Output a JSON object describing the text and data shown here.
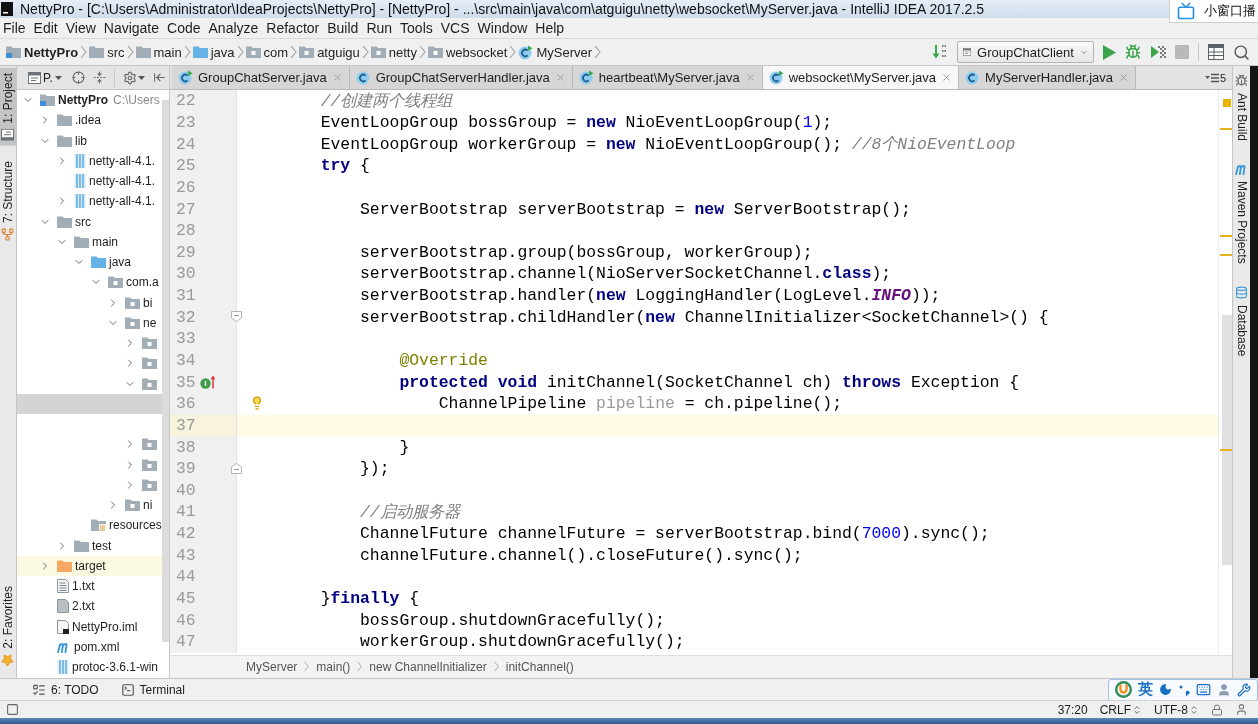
{
  "window": {
    "title": "NettyPro - [C:\\Users\\Administrator\\IdeaProjects\\NettyPro] - [NettyPro] - ...\\src\\main\\java\\com\\atguigu\\netty\\websocket\\MyServer.java - IntelliJ IDEA 2017.2.5"
  },
  "popup": {
    "label": "小窗口播"
  },
  "menu": [
    "File",
    "Edit",
    "View",
    "Navigate",
    "Code",
    "Analyze",
    "Refactor",
    "Build",
    "Run",
    "Tools",
    "VCS",
    "Window",
    "Help"
  ],
  "navigation": {
    "crumbs": [
      {
        "label": "NettyPro",
        "kind": "module"
      },
      {
        "label": "src",
        "kind": "folder"
      },
      {
        "label": "main",
        "kind": "folder"
      },
      {
        "label": "java",
        "kind": "source_folder"
      },
      {
        "label": "com",
        "kind": "package"
      },
      {
        "label": "atguigu",
        "kind": "package"
      },
      {
        "label": "netty",
        "kind": "package"
      },
      {
        "label": "websocket",
        "kind": "package"
      },
      {
        "label": "MyServer",
        "kind": "runnable_class"
      }
    ],
    "run_configuration": "GroupChatClient"
  },
  "left_tool_buttons": [
    {
      "label": "1: Project",
      "kind": "project",
      "selected": true
    },
    {
      "label": "7: Structure",
      "kind": "structure",
      "selected": false
    },
    {
      "label": "2: Favorites",
      "kind": "favorites",
      "selected": false
    }
  ],
  "project_panel": {
    "view": "P.",
    "tree": [
      {
        "label": "NettyPro",
        "location": "C:\\Users",
        "kind": "module",
        "expanded": true,
        "selected": false,
        "children": [
          {
            "label": ".idea",
            "kind": "folder",
            "expanded": false,
            "selected": false
          },
          {
            "label": "lib",
            "kind": "folder",
            "expanded": true,
            "selected": false,
            "children": [
              {
                "label": "netty-all-4.1.",
                "kind": "archive",
                "expanded": false,
                "selected": false
              },
              {
                "label": "netty-all-4.1.",
                "kind": "archive",
                "selected": false
              },
              {
                "label": "netty-all-4.1.",
                "kind": "archive",
                "expanded": false,
                "selected": false
              }
            ]
          },
          {
            "label": "src",
            "kind": "folder",
            "expanded": true,
            "selected": false,
            "children": [
              {
                "label": "main",
                "kind": "folder",
                "expanded": true,
                "selected": false,
                "children": [
                  {
                    "label": "java",
                    "kind": "source_folder",
                    "expanded": true,
                    "selected": false,
                    "children": [
                      {
                        "label": "com.a",
                        "kind": "package",
                        "expanded": true,
                        "selected": false,
                        "children": [
                          {
                            "label": "bi",
                            "kind": "package",
                            "expanded": false,
                            "selected": false
                          },
                          {
                            "label": "ne",
                            "kind": "package",
                            "expanded": true,
                            "selected": false,
                            "children": [
                              {
                                "kind": "package",
                                "expanded": false,
                                "selected": false
                              },
                              {
                                "kind": "package",
                                "expanded": false,
                                "selected": false
                              },
                              {
                                "kind": "package",
                                "expanded": true,
                                "selected": false,
                                "children": [
                                  {
                                    "selected": true
                                  },
                                  {
                                    "selected": false
                                  }
                                ]
                              },
                              {
                                "kind": "package",
                                "expanded": false,
                                "selected": false
                              },
                              {
                                "kind": "package",
                                "expanded": false,
                                "selected": false
                              },
                              {
                                "kind": "package",
                                "expanded": false,
                                "selected": false
                              }
                            ]
                          },
                          {
                            "label": "ni",
                            "kind": "package",
                            "expanded": false,
                            "selected": false
                          }
                        ]
                      }
                    ]
                  },
                  {
                    "label": "resources",
                    "kind": "resources_folder",
                    "selected": false
                  }
                ]
              },
              {
                "label": "test",
                "kind": "folder",
                "expanded": false,
                "selected": false
              }
            ]
          },
          {
            "label": "target",
            "kind": "excluded_folder",
            "expanded": false,
            "selected": false
          },
          {
            "label": "1.txt",
            "kind": "text_file",
            "selected": false
          },
          {
            "label": "2.txt",
            "kind": "unknown_file",
            "selected": false
          },
          {
            "label": "NettyPro.iml",
            "kind": "module_file",
            "selected": false
          },
          {
            "label": "pom.xml",
            "kind": "maven_file",
            "selected": false
          },
          {
            "label": "protoc-3.6.1-win",
            "kind": "archive",
            "selected": false
          }
        ]
      }
    ]
  },
  "editor": {
    "tabs": [
      {
        "label": "GroupChatServer.java",
        "kind": "runnable_class",
        "selected": false
      },
      {
        "label": "GroupChatServerHandler.java",
        "kind": "class",
        "selected": false
      },
      {
        "label": "heartbeat\\MyServer.java",
        "kind": "runnable_class",
        "selected": false
      },
      {
        "label": "websocket\\MyServer.java",
        "kind": "runnable_class",
        "selected": true
      },
      {
        "label": "MyServerHandler.java",
        "kind": "class",
        "selected": false
      }
    ],
    "hidden_tab_count": "5",
    "lines": [
      {
        "number": "22",
        "kind": "plain",
        "current": false,
        "tokens": [
          {
            "text": "        //创建两个线程组",
            "kind": "comment"
          }
        ]
      },
      {
        "number": "23",
        "kind": "plain",
        "current": false,
        "tokens": [
          {
            "text": "        EventLoopGroup bossGroup = ",
            "kind": "plain"
          },
          {
            "text": "new",
            "kind": "keyword"
          },
          {
            "text": " NioEventLoopGroup(",
            "kind": "plain"
          },
          {
            "text": "1",
            "kind": "number"
          },
          {
            "text": ");",
            "kind": "plain"
          }
        ]
      },
      {
        "number": "24",
        "kind": "plain",
        "current": false,
        "tokens": [
          {
            "text": "        EventLoopGroup workerGroup = ",
            "kind": "plain"
          },
          {
            "text": "new",
            "kind": "keyword"
          },
          {
            "text": " NioEventLoopGroup(); ",
            "kind": "plain"
          },
          {
            "text": "//8个NioEventLoop",
            "kind": "comment"
          }
        ]
      },
      {
        "number": "25",
        "kind": "plain",
        "current": false,
        "tokens": [
          {
            "text": "        try",
            "kind": "keyword"
          },
          {
            "text": " {",
            "kind": "plain"
          }
        ]
      },
      {
        "number": "26",
        "kind": "plain",
        "current": false
      },
      {
        "number": "27",
        "kind": "plain",
        "current": false,
        "tokens": [
          {
            "text": "            ServerBootstrap serverBootstrap = ",
            "kind": "plain"
          },
          {
            "text": "new",
            "kind": "keyword"
          },
          {
            "text": " ServerBootstrap();",
            "kind": "plain"
          }
        ]
      },
      {
        "number": "28",
        "kind": "plain",
        "current": false
      },
      {
        "number": "29",
        "kind": "plain",
        "current": false,
        "tokens": [
          {
            "text": "            serverBootstrap.group(bossGroup, workerGroup);",
            "kind": "plain"
          }
        ]
      },
      {
        "number": "30",
        "kind": "plain",
        "current": false,
        "tokens": [
          {
            "text": "            serverBootstrap.channel(NioServerSocketChannel.",
            "kind": "plain"
          },
          {
            "text": "class",
            "kind": "keyword"
          },
          {
            "text": ");",
            "kind": "plain"
          }
        ]
      },
      {
        "number": "31",
        "kind": "plain",
        "current": false,
        "tokens": [
          {
            "text": "            serverBootstrap.handler(",
            "kind": "plain"
          },
          {
            "text": "new",
            "kind": "keyword"
          },
          {
            "text": " LoggingHandler(LogLevel.",
            "kind": "plain"
          },
          {
            "text": "INFO",
            "kind": "constant"
          },
          {
            "text": "));",
            "kind": "plain"
          }
        ]
      },
      {
        "number": "32",
        "kind": "fold_start",
        "current": false,
        "tokens": [
          {
            "text": "            serverBootstrap.childHandler(",
            "kind": "plain"
          },
          {
            "text": "new",
            "kind": "keyword"
          },
          {
            "text": " ChannelInitializer<SocketChannel>() {",
            "kind": "plain"
          }
        ]
      },
      {
        "number": "33",
        "kind": "plain",
        "current": false
      },
      {
        "number": "34",
        "kind": "plain",
        "current": false,
        "tokens": [
          {
            "text": "                @Override",
            "kind": "annotation"
          }
        ]
      },
      {
        "number": "35",
        "kind": "implements",
        "current": false,
        "tokens": [
          {
            "text": "                protected void",
            "kind": "keyword"
          },
          {
            "text": " initChannel(SocketChannel ch) ",
            "kind": "plain"
          },
          {
            "text": "throws",
            "kind": "keyword"
          },
          {
            "text": " Exception {",
            "kind": "plain"
          }
        ]
      },
      {
        "number": "36",
        "kind": "intention",
        "current": false,
        "tokens": [
          {
            "text": "                    ChannelPipeline ",
            "kind": "plain"
          },
          {
            "text": "pipeline",
            "kind": "unused"
          },
          {
            "text": " = ch.pipeline();",
            "kind": "plain"
          }
        ]
      },
      {
        "number": "37",
        "kind": "plain",
        "current": true
      },
      {
        "number": "38",
        "kind": "plain",
        "current": false,
        "tokens": [
          {
            "text": "                }",
            "kind": "plain"
          }
        ]
      },
      {
        "number": "39",
        "kind": "fold_end",
        "current": false,
        "tokens": [
          {
            "text": "            });",
            "kind": "plain"
          }
        ]
      },
      {
        "number": "40",
        "kind": "plain",
        "current": false
      },
      {
        "number": "41",
        "kind": "plain",
        "current": false,
        "tokens": [
          {
            "text": "            //启动服务器",
            "kind": "comment"
          }
        ]
      },
      {
        "number": "42",
        "kind": "plain",
        "current": false,
        "tokens": [
          {
            "text": "            ChannelFuture channelFuture = serverBootstrap.bind(",
            "kind": "plain"
          },
          {
            "text": "7000",
            "kind": "number"
          },
          {
            "text": ").sync();",
            "kind": "plain"
          }
        ]
      },
      {
        "number": "43",
        "kind": "plain",
        "current": false,
        "tokens": [
          {
            "text": "            channelFuture.channel().closeFuture().sync();",
            "kind": "plain"
          }
        ]
      },
      {
        "number": "44",
        "kind": "plain",
        "current": false
      },
      {
        "number": "45",
        "kind": "plain",
        "current": false,
        "tokens": [
          {
            "text": "        }",
            "kind": "plain"
          },
          {
            "text": "finally",
            "kind": "keyword"
          },
          {
            "text": " {",
            "kind": "plain"
          }
        ]
      },
      {
        "number": "46",
        "kind": "plain",
        "current": false,
        "tokens": [
          {
            "text": "            bossGroup.shutdownGracefully();",
            "kind": "plain"
          }
        ]
      },
      {
        "number": "47",
        "kind": "plain",
        "current": false,
        "tokens": [
          {
            "text": "            workerGroup.shutdownGracefully();",
            "kind": "plain"
          }
        ]
      }
    ],
    "breadcrumb": [
      "MyServer",
      "main()",
      "new ChannelInitializer",
      "initChannel()"
    ]
  },
  "right_tool_buttons": [
    {
      "label": "Ant Build",
      "kind": "ant",
      "selected": false
    },
    {
      "label": "Maven Projects",
      "kind": "maven",
      "selected": false
    },
    {
      "label": "Database",
      "kind": "database",
      "selected": false
    }
  ],
  "bottom_tool_buttons": [
    {
      "label": "6: TODO",
      "kind": "todo"
    },
    {
      "label": "Terminal",
      "kind": "terminal"
    }
  ],
  "input_method": {
    "mode": "英"
  },
  "status_bar": {
    "caret": "37:20",
    "line_separator": "CRLF",
    "encoding": "UTF-8"
  }
}
